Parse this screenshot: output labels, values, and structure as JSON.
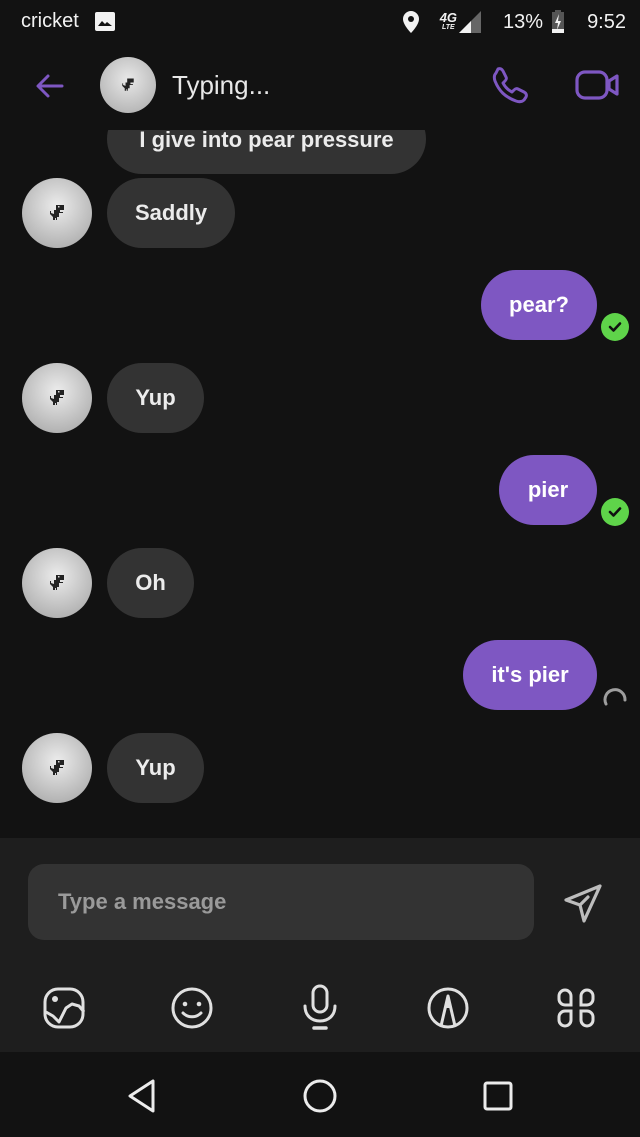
{
  "status_bar": {
    "carrier": "cricket",
    "notification_icon": "image-icon",
    "location_icon": "location-pin-icon",
    "network": "4G",
    "network_sub": "LTE",
    "battery": "13%",
    "battery_icon": "battery-charging-icon",
    "time": "9:52"
  },
  "header": {
    "title": "Typing...",
    "back_icon": "arrow-left-icon",
    "call_icon": "phone-icon",
    "video_icon": "video-camera-icon",
    "accent_color": "#7e57c2"
  },
  "messages": [
    {
      "direction": "in",
      "text": "I give into pear pressure",
      "show_avatar": false
    },
    {
      "direction": "in",
      "text": "Saddly",
      "show_avatar": true
    },
    {
      "direction": "out",
      "text": "pear?",
      "status": "delivered"
    },
    {
      "direction": "in",
      "text": "Yup",
      "show_avatar": true
    },
    {
      "direction": "out",
      "text": "pier",
      "status": "delivered"
    },
    {
      "direction": "in",
      "text": "Oh",
      "show_avatar": true
    },
    {
      "direction": "out",
      "text": "it's pier",
      "status": "sending"
    },
    {
      "direction": "in",
      "text": "Yup",
      "show_avatar": true
    }
  ],
  "colors": {
    "incoming_bubble": "#333333",
    "outgoing_bubble": "#7e57c2",
    "delivered": "#5fd44a"
  },
  "composer": {
    "placeholder": "Type a message",
    "value": "",
    "send_icon": "send-icon",
    "tools": [
      {
        "name": "gallery-icon"
      },
      {
        "name": "emoji-icon"
      },
      {
        "name": "microphone-icon"
      },
      {
        "name": "drawing-icon"
      },
      {
        "name": "apps-icon"
      }
    ]
  },
  "nav": {
    "back": "nav-back-icon",
    "home": "nav-home-icon",
    "recents": "nav-recents-icon"
  }
}
